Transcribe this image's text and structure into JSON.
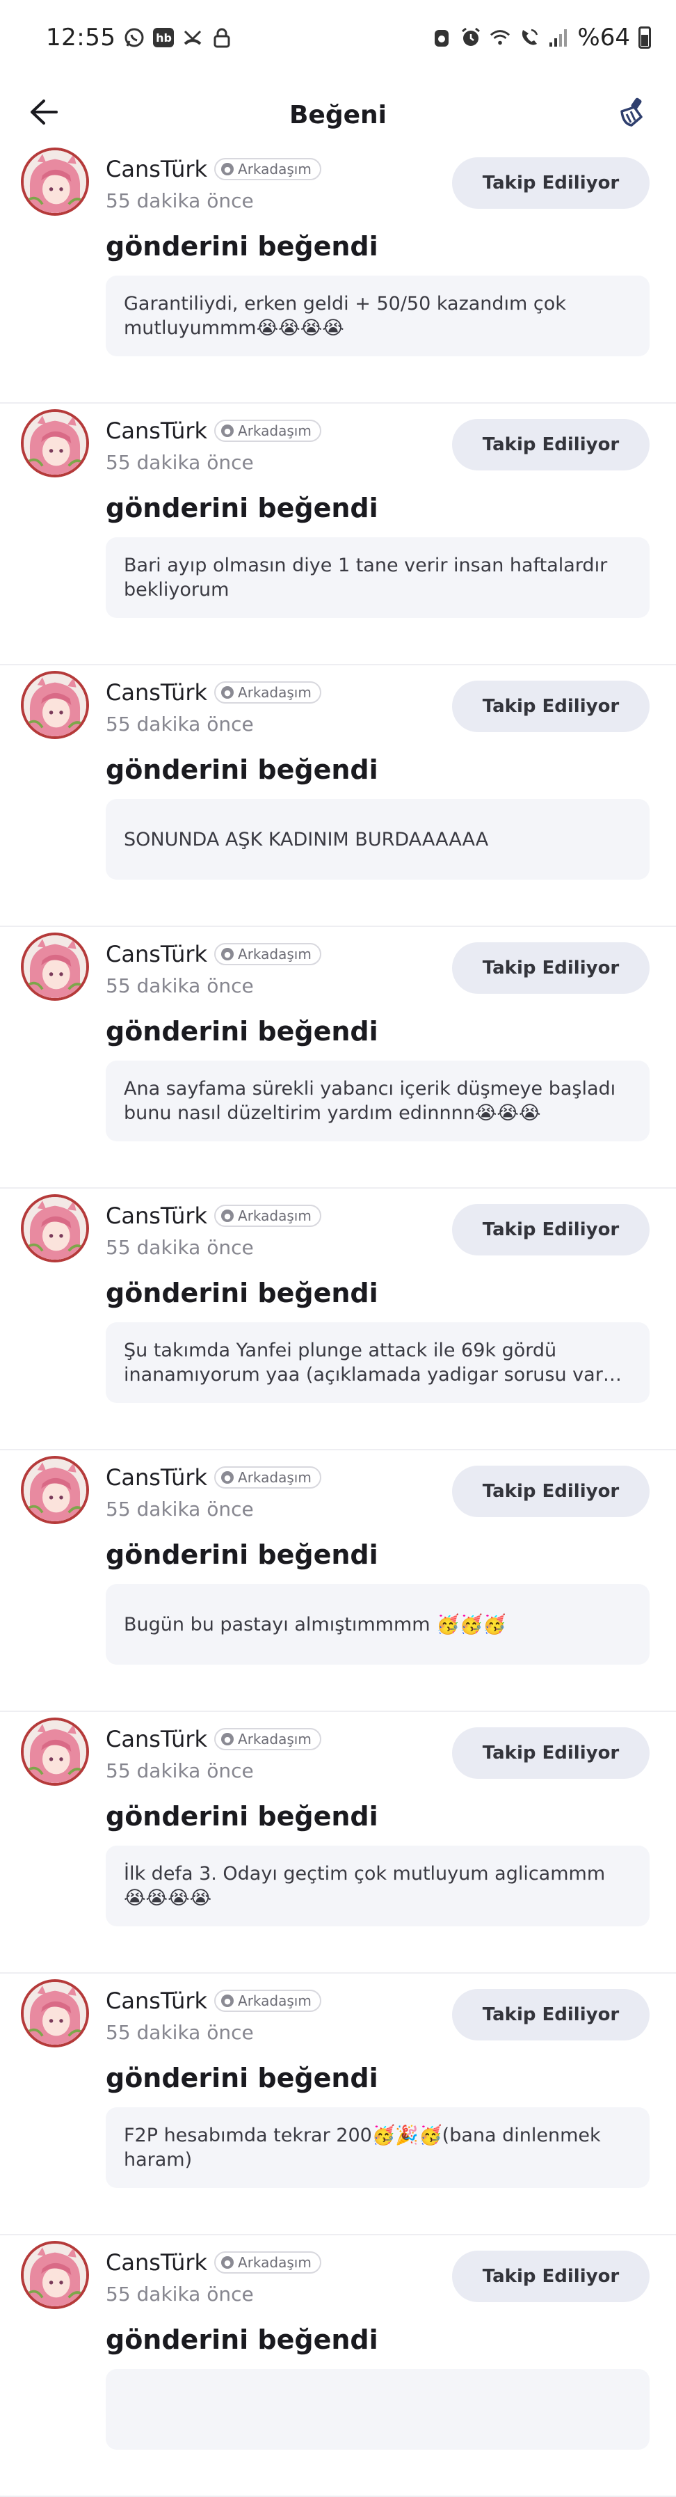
{
  "status_bar": {
    "time": "12:55",
    "battery": "%64",
    "left_icons": [
      "whatsapp-icon",
      "hb-icon",
      "missed-call-icon",
      "lock-icon"
    ],
    "right_icons": [
      "alarm-icon",
      "clock-icon",
      "wifi-icon",
      "wifi-call-icon",
      "signal-icon",
      "battery-icon"
    ]
  },
  "header": {
    "title": "Beğeni",
    "back_icon": "arrow-left-icon",
    "action_icon": "broom-icon"
  },
  "notifications": [
    {
      "user": "CansTürk",
      "badge": "Arkadaşım",
      "time": "55 dakika önce",
      "button": "Takip Ediliyor",
      "action": "gönderini beğendi",
      "post": "Garantiliydi, erken geldi + 50/50 kazandım çok mutluyummm😭😭😭😭"
    },
    {
      "user": "CansTürk",
      "badge": "Arkadaşım",
      "time": "55 dakika önce",
      "button": "Takip Ediliyor",
      "action": "gönderini beğendi",
      "post": "Bari ayıp olmasın diye 1 tane verir insan haftalardır bekliyorum"
    },
    {
      "user": "CansTürk",
      "badge": "Arkadaşım",
      "time": "55 dakika önce",
      "button": "Takip Ediliyor",
      "action": "gönderini beğendi",
      "post": "SONUNDA AŞK KADINIM BURDAAAAAA"
    },
    {
      "user": "CansTürk",
      "badge": "Arkadaşım",
      "time": "55 dakika önce",
      "button": "Takip Ediliyor",
      "action": "gönderini beğendi",
      "post": "Ana sayfama sürekli yabancı içerik düşmeye başladı bunu nasıl düzeltirim yardım edinnnn😭😭😭"
    },
    {
      "user": "CansTürk",
      "badge": "Arkadaşım",
      "time": "55 dakika önce",
      "button": "Takip Ediliyor",
      "action": "gönderini beğendi",
      "post": "Şu takımda Yanfei plunge attack ile 69k gördü inanamıyorum yaa (açıklamada yadigar sorusu var baka..."
    },
    {
      "user": "CansTürk",
      "badge": "Arkadaşım",
      "time": "55 dakika önce",
      "button": "Takip Ediliyor",
      "action": "gönderini beğendi",
      "post": "Bugün bu pastayı almıştımmmm 🥳🥳🥳"
    },
    {
      "user": "CansTürk",
      "badge": "Arkadaşım",
      "time": "55 dakika önce",
      "button": "Takip Ediliyor",
      "action": "gönderini beğendi",
      "post": "İlk defa 3. Odayı geçtim çok mutluyum aglicammm 😭😭😭😭"
    },
    {
      "user": "CansTürk",
      "badge": "Arkadaşım",
      "time": "55 dakika önce",
      "button": "Takip Ediliyor",
      "action": "gönderini beğendi",
      "post": "F2P hesabımda tekrar 200🥳🎉🥳(bana dinlenmek haram)"
    },
    {
      "user": "CansTürk",
      "badge": "Arkadaşım",
      "time": "55 dakika önce",
      "button": "Takip Ediliyor",
      "action": "gönderini beğendi",
      "post": ""
    }
  ]
}
